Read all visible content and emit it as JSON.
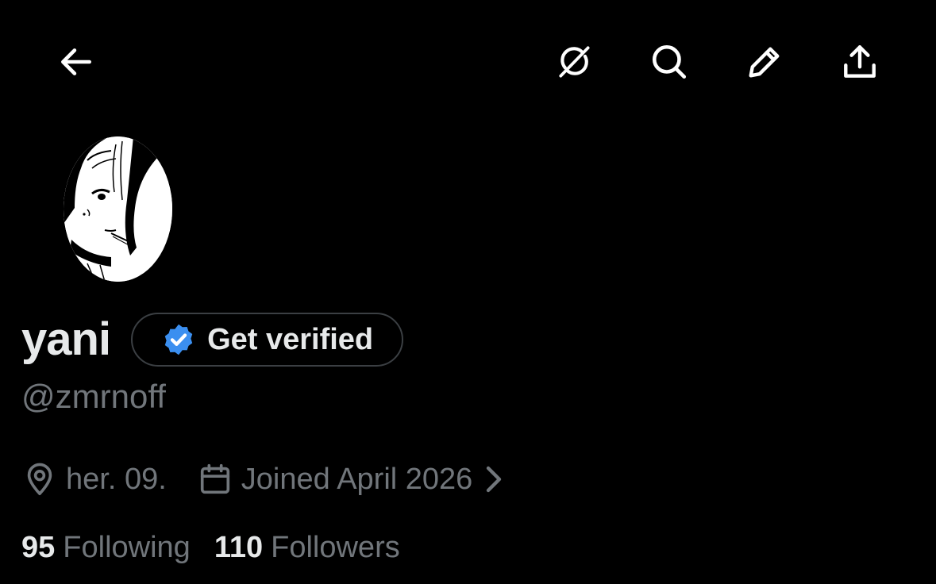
{
  "profile": {
    "display_name": "yani",
    "handle": "@zmrnoff",
    "verify_label": "Get verified",
    "location": "her. 09.",
    "joined": "Joined April 2026",
    "following_count": "95",
    "following_label": "Following",
    "followers_count": "110",
    "followers_label": "Followers"
  },
  "icons": {
    "back": "back-arrow-icon",
    "grok": "grok-icon",
    "search": "search-icon",
    "edit": "pencil-icon",
    "share": "share-upload-icon",
    "verified": "verified-badge-icon",
    "location": "location-pin-icon",
    "calendar": "calendar-icon",
    "chevron": "chevron-right-icon"
  },
  "colors": {
    "background": "#000000",
    "primary_text": "#e7e9ea",
    "secondary_text": "#71767b",
    "border": "#3b3f43",
    "verified_blue": "#1d9bf0"
  }
}
